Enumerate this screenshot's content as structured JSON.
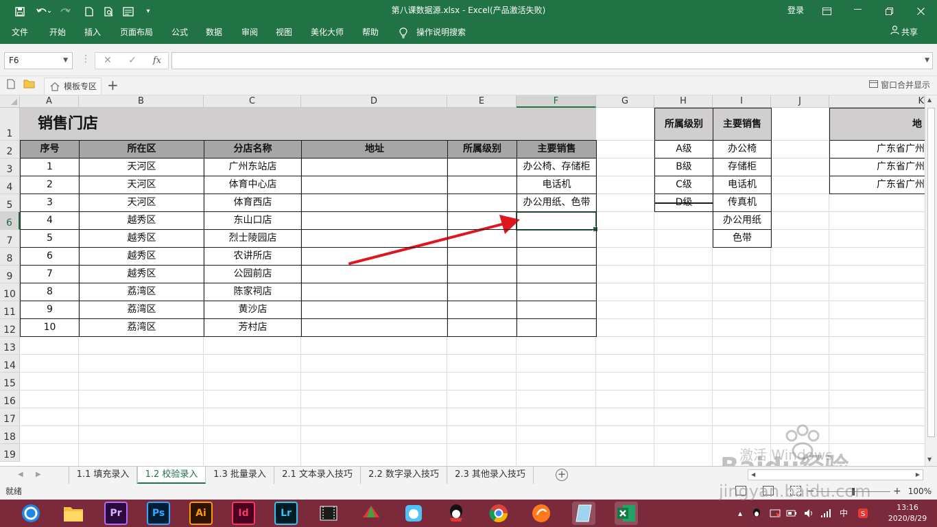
{
  "app": {
    "window_title": "第八课数据源.xlsx  -  Excel(产品激活失败)",
    "login": "登录",
    "share": "共享",
    "colors": {
      "brand": "#217346",
      "header_fill": "#a6a6a6",
      "title_fill": "#d0cece",
      "arrow": "#e0161e",
      "taskbar": "#7b2a3c"
    }
  },
  "ribbon": {
    "tabs": [
      "文件",
      "开始",
      "插入",
      "页面布局",
      "公式",
      "数据",
      "审阅",
      "视图",
      "美化大师",
      "帮助",
      "操作说明搜索"
    ]
  },
  "formula_bar": {
    "name_box": "F6",
    "cancel": "✕",
    "enter": "✓",
    "fx": "fx",
    "content": ""
  },
  "doc_tabs": {
    "tab": "模板专区",
    "right_label": "窗口合并显示"
  },
  "sheet": {
    "columns": [
      "A",
      "B",
      "C",
      "D",
      "E",
      "F",
      "G",
      "H",
      "I",
      "J",
      "K"
    ],
    "rows": [
      "1",
      "2",
      "3",
      "4",
      "5",
      "6",
      "7",
      "8",
      "9",
      "10",
      "11",
      "12",
      "13",
      "14",
      "15",
      "16",
      "17",
      "18",
      "19"
    ],
    "title": "销售门店",
    "headers": [
      "序号",
      "所在区",
      "分店名称",
      "地址",
      "所属级别",
      "主要销售"
    ],
    "data": [
      [
        "1",
        "天河区",
        "广州东站店",
        "",
        "",
        "办公椅、存储柜"
      ],
      [
        "2",
        "天河区",
        "体育中心店",
        "",
        "",
        "电话机"
      ],
      [
        "3",
        "天河区",
        "体育西店",
        "",
        "",
        "办公用纸、色带"
      ],
      [
        "4",
        "越秀区",
        "东山口店",
        "",
        "",
        ""
      ],
      [
        "5",
        "越秀区",
        "烈士陵园店",
        "",
        "",
        ""
      ],
      [
        "6",
        "越秀区",
        "农讲所店",
        "",
        "",
        ""
      ],
      [
        "7",
        "越秀区",
        "公园前店",
        "",
        "",
        ""
      ],
      [
        "8",
        "荔湾区",
        "陈家祠店",
        "",
        "",
        ""
      ],
      [
        "9",
        "荔湾区",
        "黄沙店",
        "",
        "",
        ""
      ],
      [
        "10",
        "荔湾区",
        "芳村店",
        "",
        "",
        ""
      ]
    ],
    "level_header": "所属级别",
    "levels": [
      "A级",
      "B级",
      "C级",
      "D级"
    ],
    "product_header": "主要销售",
    "products": [
      "办公椅",
      "存储柜",
      "电话机",
      "传真机",
      "办公用纸",
      "色带"
    ],
    "address_header": "地",
    "addresses": [
      "广东省广州",
      "广东省广州",
      "广东省广州"
    ],
    "selected_cell": "F6"
  },
  "sheet_tabs": [
    "1.1 填充录入",
    "1.2 校验录入",
    "1.3 批量录入",
    "2.1 文本录入技巧",
    "2.2 数字录入技巧",
    "2.3 其他录入技巧"
  ],
  "active_sheet": "1.2 校验录入",
  "status": {
    "ready": "就绪",
    "zoom": "100%"
  },
  "taskbar": {
    "apps": [
      "Pr",
      "Ps",
      "Ai",
      "Id",
      "Lr"
    ],
    "time": "13:16",
    "date": "2020/8/29",
    "ime": "中"
  },
  "watermark": {
    "line1": "激活 Windows",
    "brand": "Baidu经验",
    "url": "jingyan.baidu.com"
  }
}
